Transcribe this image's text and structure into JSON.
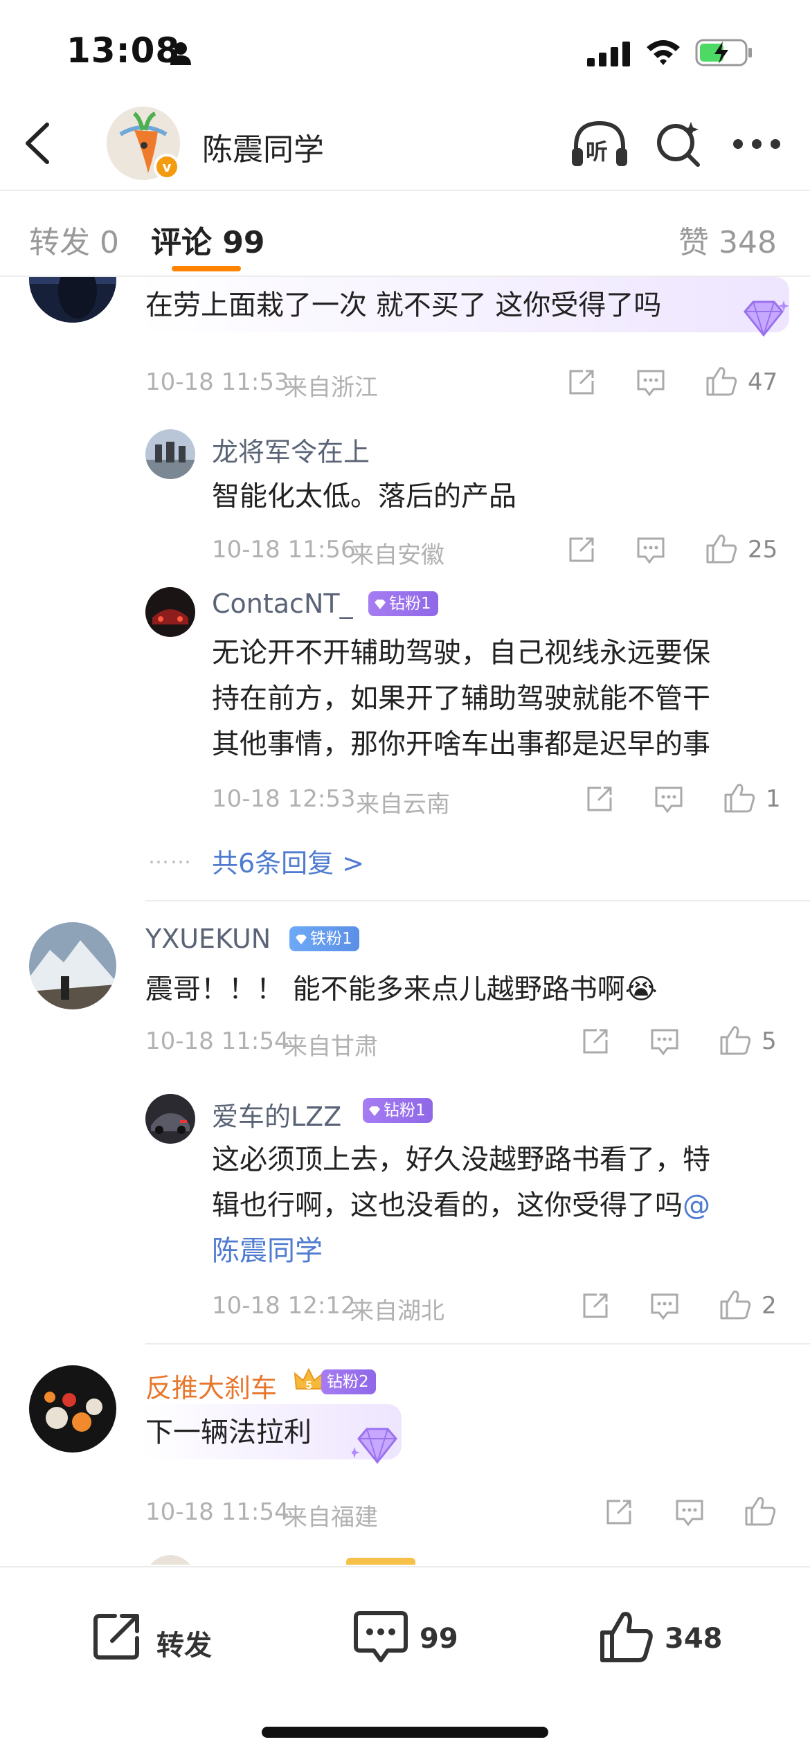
{
  "status": {
    "time": "13:08"
  },
  "nav": {
    "title": "陈震同学",
    "avatar_badge": "v",
    "listen": "听"
  },
  "tabs": {
    "repost": "转发 0",
    "comments": "评论 99",
    "likes": "赞 348"
  },
  "comments": [
    {
      "text": "在劳上面栽了一次 就不买了 这你受得了吗",
      "date": "10-18 11:53",
      "location": "来自浙江",
      "likes": "47",
      "replies": [
        {
          "name": "龙将军令在上",
          "text": "智能化太低。落后的产品",
          "date": "10-18 11:56",
          "location": "来自安徽",
          "likes": "25"
        },
        {
          "name": "ContacNT_",
          "badge": "钻粉1",
          "lines": [
            "无论开不开辅助驾驶，自己视线永远要保",
            "持在前方，如果开了辅助驾驶就能不管干",
            "其他事情，那你开啥车出事都是迟早的事"
          ],
          "date": "10-18 12:53",
          "location": "来自云南",
          "likes": "1"
        }
      ],
      "more_replies": "共6条回复 >",
      "more_dots": "……"
    },
    {
      "name": "YXUEKUN",
      "badge": "铁粉1",
      "text": "震哥！！！ 能不能多来点儿越野路书啊",
      "emoji": "😭",
      "date": "10-18 11:54",
      "location": "来自甘肃",
      "likes": "5",
      "replies": [
        {
          "name": "爱车的LZZ",
          "badge": "钻粉1",
          "lines": [
            "这必须顶上去，好久没越野路书看了，特",
            "辑也行啊，这也没看的，这你受得了吗"
          ],
          "mention_at": "@",
          "mention_name": "陈震同学",
          "date": "10-18 12:12",
          "location": "来自湖北",
          "likes": "2"
        }
      ]
    },
    {
      "name": "反推大刹车",
      "crown": "5",
      "badge": "钻粉2",
      "text": "下一辆法拉利",
      "date": "10-18 11:54",
      "location": "来自福建"
    }
  ],
  "bottom": {
    "repost": "转发",
    "comments": "99",
    "likes": "348"
  },
  "colors": {
    "accent": "#ff8200",
    "link": "#4f7bd0",
    "name": "#5a6476",
    "meta": "#b1b1b1",
    "fan_purple": "#9a72ee",
    "fan_blue": "#6ea9f6"
  }
}
